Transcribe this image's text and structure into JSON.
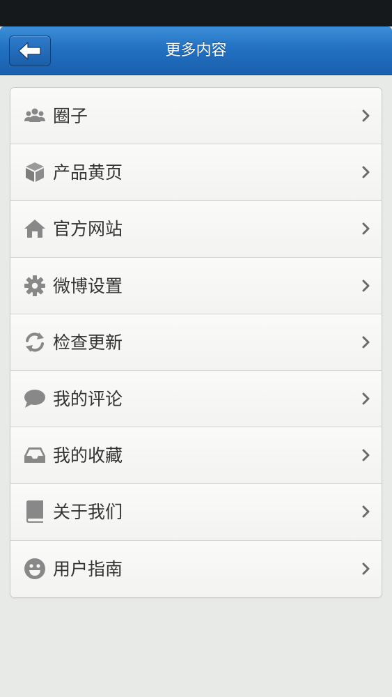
{
  "header": {
    "title": "更多内容",
    "back_icon": "arrow-left-icon"
  },
  "menu": {
    "items": [
      {
        "label": "圈子",
        "icon": "group-icon"
      },
      {
        "label": "产品黄页",
        "icon": "cube-icon"
      },
      {
        "label": "官方网站",
        "icon": "home-icon"
      },
      {
        "label": "微博设置",
        "icon": "gear-icon"
      },
      {
        "label": "检查更新",
        "icon": "refresh-icon"
      },
      {
        "label": "我的评论",
        "icon": "comment-icon"
      },
      {
        "label": "我的收藏",
        "icon": "inbox-icon"
      },
      {
        "label": "关于我们",
        "icon": "book-icon"
      },
      {
        "label": "用户指南",
        "icon": "smiley-icon"
      }
    ]
  },
  "colors": {
    "header_blue": "#2271c2",
    "icon_gray": "#888888",
    "text": "#333333",
    "background": "#e8eae8"
  }
}
